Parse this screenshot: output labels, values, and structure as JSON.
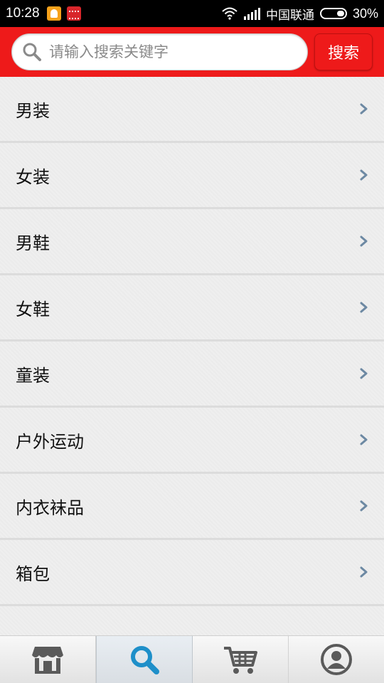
{
  "status_bar": {
    "time": "10:28",
    "carrier": "中国联通",
    "battery": "30%"
  },
  "search": {
    "placeholder": "请输入搜索关键字",
    "button_label": "搜索"
  },
  "categories": [
    {
      "label": "男装"
    },
    {
      "label": "女装"
    },
    {
      "label": "男鞋"
    },
    {
      "label": "女鞋"
    },
    {
      "label": "童装"
    },
    {
      "label": "户外运动"
    },
    {
      "label": "内衣袜品"
    },
    {
      "label": "箱包"
    }
  ],
  "bottom_nav": {
    "active_index": 1,
    "items": [
      {
        "icon": "store-icon"
      },
      {
        "icon": "search-icon"
      },
      {
        "icon": "cart-icon"
      },
      {
        "icon": "user-icon"
      }
    ]
  },
  "colors": {
    "header": "#ee1a1a",
    "active_nav_icon": "#1e8fc9",
    "nav_icon": "#5a5a5a",
    "chevron": "#6d89a3"
  }
}
